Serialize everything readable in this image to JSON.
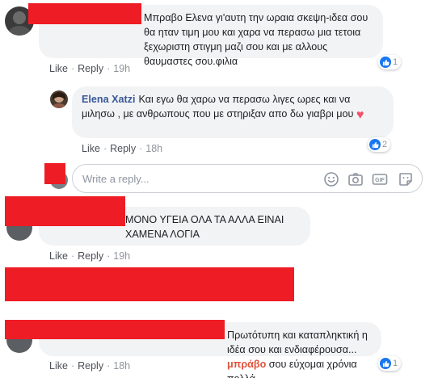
{
  "comments": [
    {
      "text": "Μπραβο Ελενα γι'αυτη την ωραια σκεψη-ιδεα σου θα ηταν τιμη μου και χαρα να περασω μια τετοια ξεχωριστη στιγμη μαζι σου και με αλλους θαυμαστες σου.φιλια",
      "like_label": "Like",
      "reply_label": "Reply",
      "time": "19h",
      "reaction_count": "1"
    },
    {
      "author": "Elena Xatzi",
      "text": "Και εγω θα χαρω να περασω λιγες ωρες και να μιλησω , με ανθρωπους που με στηριξαν απο δω γιαβρι μου",
      "emoji": "heart",
      "like_label": "Like",
      "reply_label": "Reply",
      "time": "18h",
      "reaction_count": "2"
    },
    {
      "text": "ΜΟΝΟ ΥΓΕΙΑ ΟΛΑ ΤΑ ΑΛΛΑ ΕΙΝΑΙ ΧΑΜΕΝΑ ΛΟΓΙΑ",
      "like_label": "Like",
      "reply_label": "Reply",
      "time": "19h"
    },
    {
      "text_before": "Πρωτότυπη και καταπληκτική η ιδέα σου και ενδιαφέρουσα...",
      "highlight": "μπράβο",
      "text_after": "σου εύχομαι χρόνια πολλά",
      "like_label": "Like",
      "reply_label": "Reply",
      "time": "18h",
      "reaction_count": "1"
    }
  ],
  "reply_box": {
    "placeholder": "Write a reply...",
    "icons": [
      "smiley-icon",
      "camera-icon",
      "gif-icon",
      "sticker-icon"
    ]
  },
  "colors": {
    "redaction": "#ee1c24",
    "author_link": "#385898",
    "bubble_bg": "#f2f3f5",
    "like_blue": "#1877f2",
    "highlight_orange": "#e0533b"
  }
}
